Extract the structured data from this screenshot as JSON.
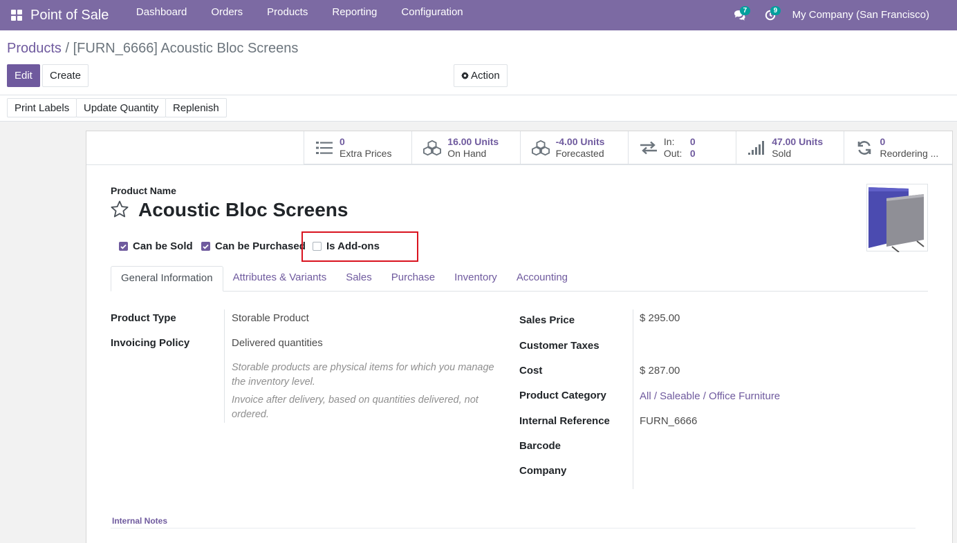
{
  "navbar": {
    "app_title": "Point of Sale",
    "menu": [
      "Dashboard",
      "Orders",
      "Products",
      "Reporting",
      "Configuration"
    ],
    "messages_badge": "7",
    "activities_badge": "9",
    "company": "My Company (San Francisco)"
  },
  "breadcrumb": {
    "parent": "Products",
    "separator": " / ",
    "current": "[FURN_6666] Acoustic Bloc Screens"
  },
  "actions": {
    "edit": "Edit",
    "create": "Create",
    "action": "Action",
    "print_labels": "Print Labels",
    "update_quantity": "Update Quantity",
    "replenish": "Replenish"
  },
  "stats": {
    "extra_prices_value": "0",
    "extra_prices_label": "Extra Prices",
    "on_hand_value": "16.00 Units",
    "on_hand_label": "On Hand",
    "forecasted_value": "-4.00 Units",
    "forecasted_label": "Forecasted",
    "in_label": "In:",
    "in_value": "0",
    "out_label": "Out:",
    "out_value": "0",
    "sold_value": "47.00 Units",
    "sold_label": "Sold",
    "reordering_value": "0",
    "reordering_label": "Reordering ..."
  },
  "product": {
    "name_label": "Product Name",
    "name": "Acoustic Bloc Screens",
    "can_be_sold_label": "Can be Sold",
    "can_be_sold": true,
    "can_be_purchased_label": "Can be Purchased",
    "can_be_purchased": true,
    "is_addons_label": "Is Add-ons",
    "is_addons": false
  },
  "tabs": [
    "General Information",
    "Attributes & Variants",
    "Sales",
    "Purchase",
    "Inventory",
    "Accounting"
  ],
  "active_tab": "General Information",
  "general": {
    "product_type_label": "Product Type",
    "product_type": "Storable Product",
    "invoicing_policy_label": "Invoicing Policy",
    "invoicing_policy": "Delivered quantities",
    "help_type": "Storable products are physical items for which you manage the inventory level.",
    "help_invoice": "Invoice after delivery, based on quantities delivered, not ordered.",
    "sales_price_label": "Sales Price",
    "sales_price": "$ 295.00",
    "customer_taxes_label": "Customer Taxes",
    "customer_taxes": "",
    "cost_label": "Cost",
    "cost": "$ 287.00",
    "product_category_label": "Product Category",
    "product_category": "All / Saleable / Office Furniture",
    "internal_reference_label": "Internal Reference",
    "internal_reference": "FURN_6666",
    "barcode_label": "Barcode",
    "barcode": "",
    "company_label": "Company",
    "company": ""
  },
  "internal_notes_label": "Internal Notes",
  "colors": {
    "brand": "#7c6aa3",
    "accent": "#6f5a9e",
    "badge": "#00a09d",
    "highlight_box": "#d9131f"
  },
  "icons": {
    "apps": "grid-icon",
    "messages": "chat-icon",
    "activities": "clock-icon",
    "action": "gear-icon",
    "extra_prices": "list-icon",
    "on_hand": "cubes-icon",
    "forecasted": "cubes-icon",
    "in_out": "exchange-icon",
    "sold": "bar-chart-icon",
    "reordering": "refresh-icon",
    "favorite": "star-icon"
  }
}
